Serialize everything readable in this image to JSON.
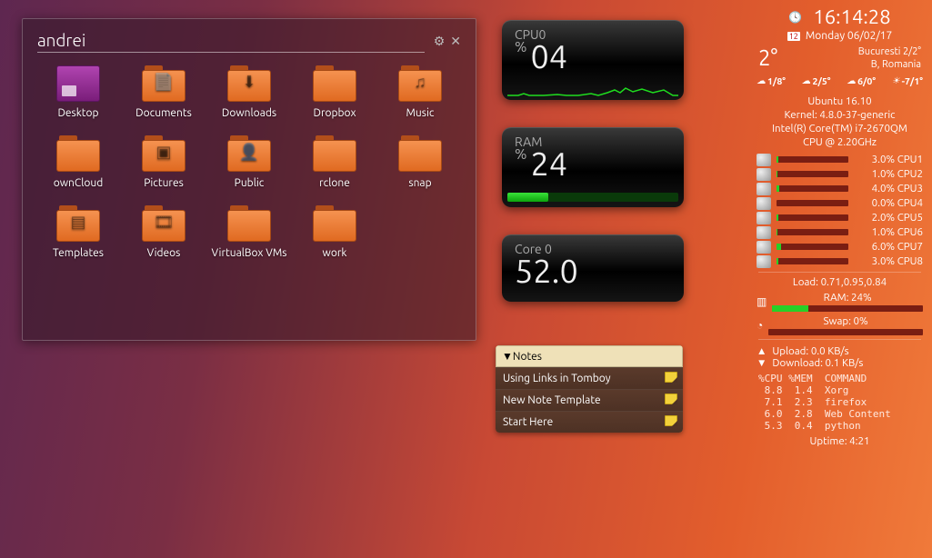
{
  "browser": {
    "path": "andrei",
    "items": [
      {
        "label": "Desktop",
        "icon": "desktop"
      },
      {
        "label": "Documents",
        "icon": "folder",
        "glyph": "📄"
      },
      {
        "label": "Downloads",
        "icon": "folder",
        "glyph": "⬇"
      },
      {
        "label": "Dropbox",
        "icon": "folder"
      },
      {
        "label": "Music",
        "icon": "folder",
        "glyph": "♫"
      },
      {
        "label": "ownCloud",
        "icon": "folder"
      },
      {
        "label": "Pictures",
        "icon": "folder",
        "glyph": "▣"
      },
      {
        "label": "Public",
        "icon": "folder",
        "glyph": "👤"
      },
      {
        "label": "rclone",
        "icon": "folder"
      },
      {
        "label": "snap",
        "icon": "folder"
      },
      {
        "label": "Templates",
        "icon": "folder",
        "glyph": "▤"
      },
      {
        "label": "Videos",
        "icon": "folder",
        "glyph": "🎞"
      },
      {
        "label": "VirtualBox VMs",
        "icon": "folder"
      },
      {
        "label": "work",
        "icon": "folder"
      }
    ]
  },
  "gauges": {
    "cpu": {
      "title": "CPU0",
      "pct": "%",
      "value": "04",
      "fill": 4
    },
    "ram": {
      "title": "RAM",
      "pct": "%",
      "value": "24",
      "fill": 24
    },
    "core": {
      "title": "Core 0",
      "value": "52.0"
    }
  },
  "notes": {
    "header": "▼Notes",
    "rows": [
      "Using Links in Tomboy",
      "New Note Template",
      "Start Here"
    ]
  },
  "sidebar": {
    "time": "16:14:28",
    "cal_day": "12",
    "date": "Monday 06/02/17",
    "temp": "2°",
    "loc1": "Bucuresti 2/2°",
    "loc2": "B, Romania",
    "forecast": [
      "1/8°",
      "2/5°",
      "6/0°",
      "-7/1°"
    ],
    "os": "Ubuntu 16.10",
    "kernel": "Kernel: 4.8.0-37-generic",
    "cpu_model1": "Intel(R) Core(TM) i7-2670QM",
    "cpu_model2": "CPU @ 2.20GHz",
    "cpus": [
      {
        "pct": 3.0,
        "label": "3.0% CPU1"
      },
      {
        "pct": 1.0,
        "label": "1.0% CPU2"
      },
      {
        "pct": 4.0,
        "label": "4.0% CPU3"
      },
      {
        "pct": 0.0,
        "label": "0.0% CPU4"
      },
      {
        "pct": 2.0,
        "label": "2.0% CPU5"
      },
      {
        "pct": 1.0,
        "label": "1.0% CPU6"
      },
      {
        "pct": 6.0,
        "label": "6.0% CPU7"
      },
      {
        "pct": 3.0,
        "label": "3.0% CPU8"
      }
    ],
    "load": "Load: 0.71,0.95,0.84",
    "ram_label": "RAM: 24%",
    "ram_pct": 24,
    "swap_label": "Swap: 0%",
    "swap_pct": 0,
    "upload": "Upload: 0.0 KB/s",
    "download": "Download: 0.1 KB/s",
    "proc_header": "%CPU %MEM  COMMAND",
    "procs": [
      " 8.8  1.4  Xorg",
      " 7.1  2.3  firefox",
      " 6.0  2.8  Web Content",
      " 5.3  0.4  python"
    ],
    "uptime": "Uptime: 4:21"
  }
}
